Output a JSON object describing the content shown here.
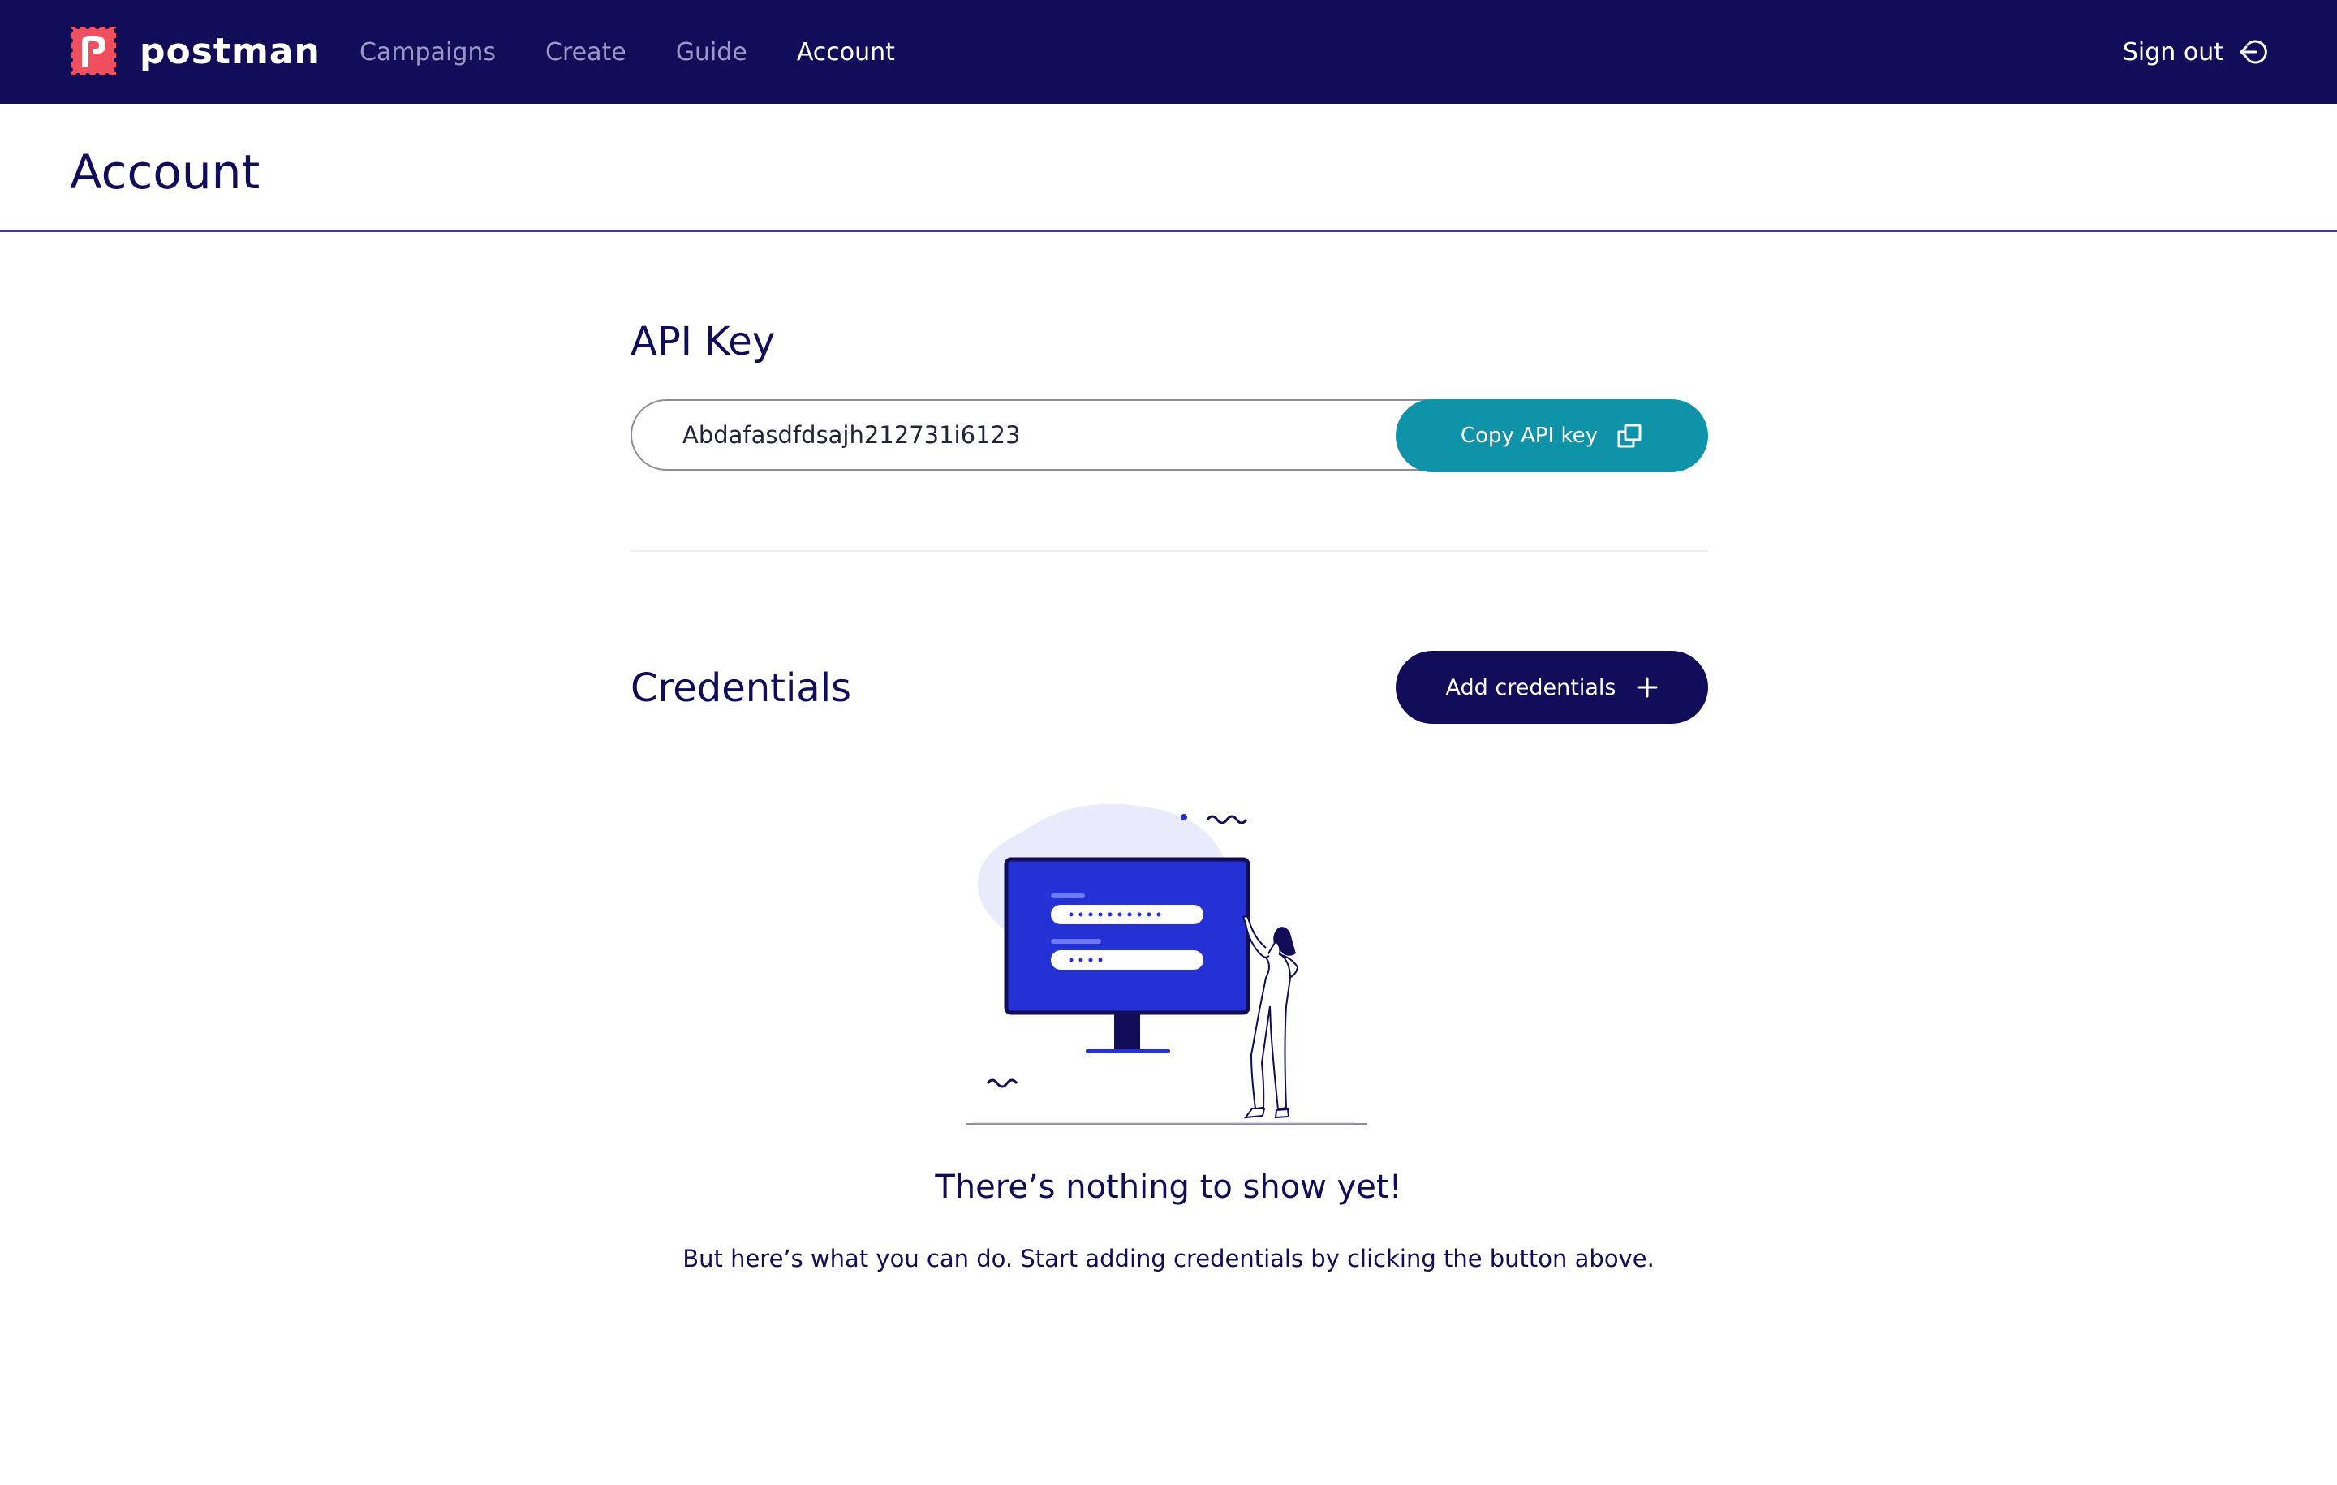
{
  "app": {
    "name": "postman",
    "colors": {
      "nav_bg": "#110d58",
      "accent": "#0e93a8",
      "logo": "#f0505d",
      "illustration_blue": "#2431d4"
    }
  },
  "nav": {
    "items": [
      {
        "label": "Campaigns",
        "active": false
      },
      {
        "label": "Create",
        "active": false
      },
      {
        "label": "Guide",
        "active": false
      },
      {
        "label": "Account",
        "active": true
      }
    ],
    "sign_out_label": "Sign out",
    "sign_out_icon": "sign-out-icon"
  },
  "page": {
    "title": "Account"
  },
  "api_key": {
    "heading": "API Key",
    "value": "Abdafasdfdsajh212731i6123",
    "copy_button_label": "Copy API key",
    "copy_icon": "copy-icon"
  },
  "credentials": {
    "heading": "Credentials",
    "add_button_label": "Add credentials",
    "add_icon": "plus-icon",
    "empty_state": {
      "title": "There’s nothing to show yet!",
      "description": "But here’s what you can do. Start adding credentials by clicking the button above.",
      "illustration": "monitor-with-login-form-illustration"
    }
  }
}
